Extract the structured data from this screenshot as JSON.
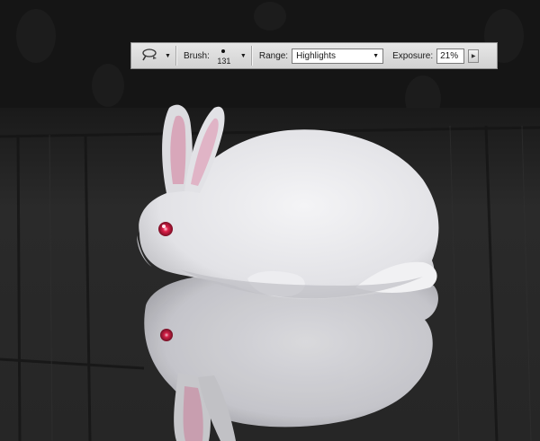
{
  "options_bar": {
    "tool_preset_icon": "dodge-tool-icon",
    "brush_label": "Brush:",
    "brush_size": "131",
    "range_label": "Range:",
    "range_value": "Highlights",
    "exposure_label": "Exposure:",
    "exposure_value": "21%"
  },
  "colors": {
    "background": "#141414",
    "floor": "#2a2a2a",
    "rabbit_fur": "#e8e8ec",
    "rabbit_eye": "#d81e4a",
    "ear_inner": "#e4b7c8"
  }
}
